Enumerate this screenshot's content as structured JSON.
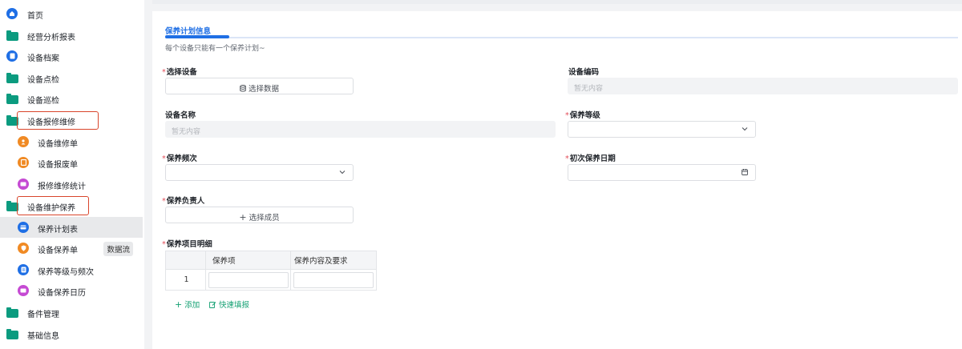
{
  "sidebar": {
    "items": [
      {
        "label": "首页",
        "icon": "home-icon"
      },
      {
        "label": "经营分析报表",
        "icon": "folder-icon"
      },
      {
        "label": "设备档案",
        "icon": "archive-icon"
      },
      {
        "label": "设备点检",
        "icon": "folder-icon"
      },
      {
        "label": "设备巡检",
        "icon": "folder-icon"
      },
      {
        "label": "设备报修维修",
        "icon": "folder-open-icon"
      },
      {
        "label": "设备维修单",
        "icon": "repair-icon"
      },
      {
        "label": "设备报废单",
        "icon": "scrap-icon"
      },
      {
        "label": "报修维修统计",
        "icon": "stats-icon"
      },
      {
        "label": "设备维护保养",
        "icon": "folder-open-icon"
      },
      {
        "label": "保养计划表",
        "icon": "plan-icon"
      },
      {
        "label": "设备保养单",
        "icon": "shield-icon",
        "badge": "数据流"
      },
      {
        "label": "保养等级与频次",
        "icon": "level-icon"
      },
      {
        "label": "设备保养日历",
        "icon": "calendar-icon"
      },
      {
        "label": "备件管理",
        "icon": "folder-icon"
      },
      {
        "label": "基础信息",
        "icon": "folder-icon"
      }
    ]
  },
  "form": {
    "section_title": "保养计划信息",
    "section_hint": "每个设备只能有一个保养计划~",
    "required_mark": "*",
    "select_device_label": "选择设备",
    "select_device_button": "选择数据",
    "device_code_label": "设备编码",
    "device_code_placeholder": "暂无内容",
    "device_name_label": "设备名称",
    "device_name_placeholder": "暂无内容",
    "maint_level_label": "保养等级",
    "maint_freq_label": "保养频次",
    "first_date_label": "初次保养日期",
    "owner_label": "保养负责人",
    "owner_button": "选择成员",
    "details_label": "保养项目明细",
    "table": {
      "headers": [
        "",
        "保养项",
        "保养内容及要求"
      ],
      "rows": [
        {
          "index": "1"
        }
      ]
    },
    "add_link": "添加",
    "quick_fill_link": "快速填报"
  },
  "colors": {
    "accent": "#0b9b7f",
    "primary_blue": "#1f6fe5",
    "required": "#e34d59",
    "highlight_box": "#d9452b"
  }
}
